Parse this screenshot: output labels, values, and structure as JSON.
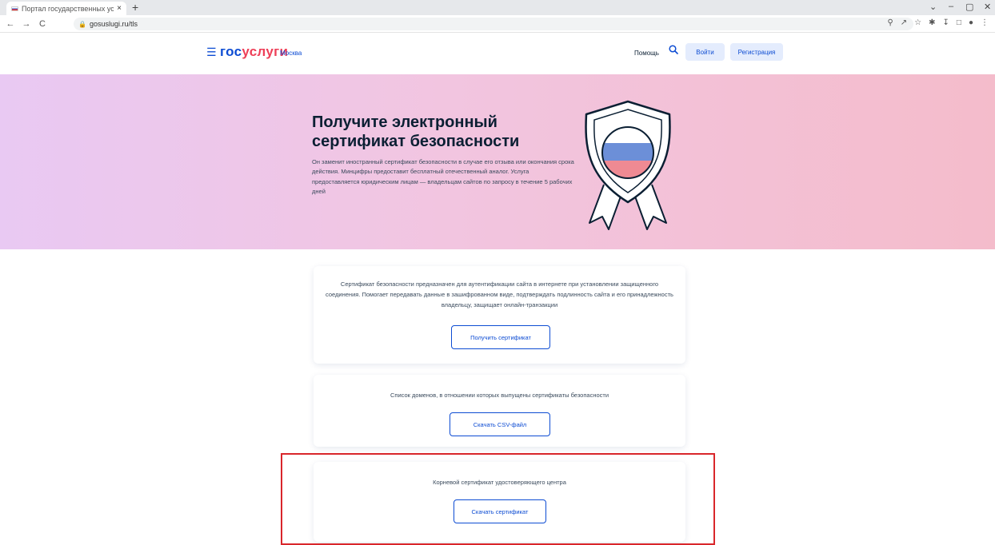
{
  "browser": {
    "tab_title": "Портал государственных услуг",
    "tab_close": "×",
    "new_tab": "+",
    "url": "gosuslugi.ru/tls",
    "back": "←",
    "forward": "→",
    "reload": "C",
    "window_controls": [
      "⌄",
      "–",
      "▢",
      "✕"
    ]
  },
  "header": {
    "menu_icon": "menu-icon",
    "logo_gos": "гос",
    "logo_uslugi": "услуги",
    "city": "Москва",
    "help": "Помощь",
    "login": "Войти",
    "register": "Регистрация"
  },
  "hero": {
    "title_line1": "Получите электронный",
    "title_line2": "сертификат безопасности",
    "description": "Он заменит иностранный сертификат безопасности в случае его отзыва или окончания срока действия. Минцифры предоставит бесплатный отечественный аналог. Услуга предоставляется юридическим лицам — владельцам сайтов по запросу в течение 5 рабочих дней"
  },
  "cards": [
    {
      "text": "Сертификат безопасности предназначен для аутентификации сайта в интернете при установлении защищенного соединения. Помогает передавать данные в зашифрованном виде, подтверждать подлинность сайта и его принадлежность владельцу, защищает онлайн-транзакции",
      "button": "Получить сертификат"
    },
    {
      "text": "Список доменов, в отношении которых выпущены сертификаты безопасности",
      "button": "Скачать CSV-файл"
    },
    {
      "text": "Корневой сертификат удостоверяющего центра",
      "button": "Скачать сертификат"
    }
  ],
  "colors": {
    "brand_blue": "#0d4cd3",
    "brand_red": "#ee3f58",
    "highlight_red": "#d9262b"
  }
}
